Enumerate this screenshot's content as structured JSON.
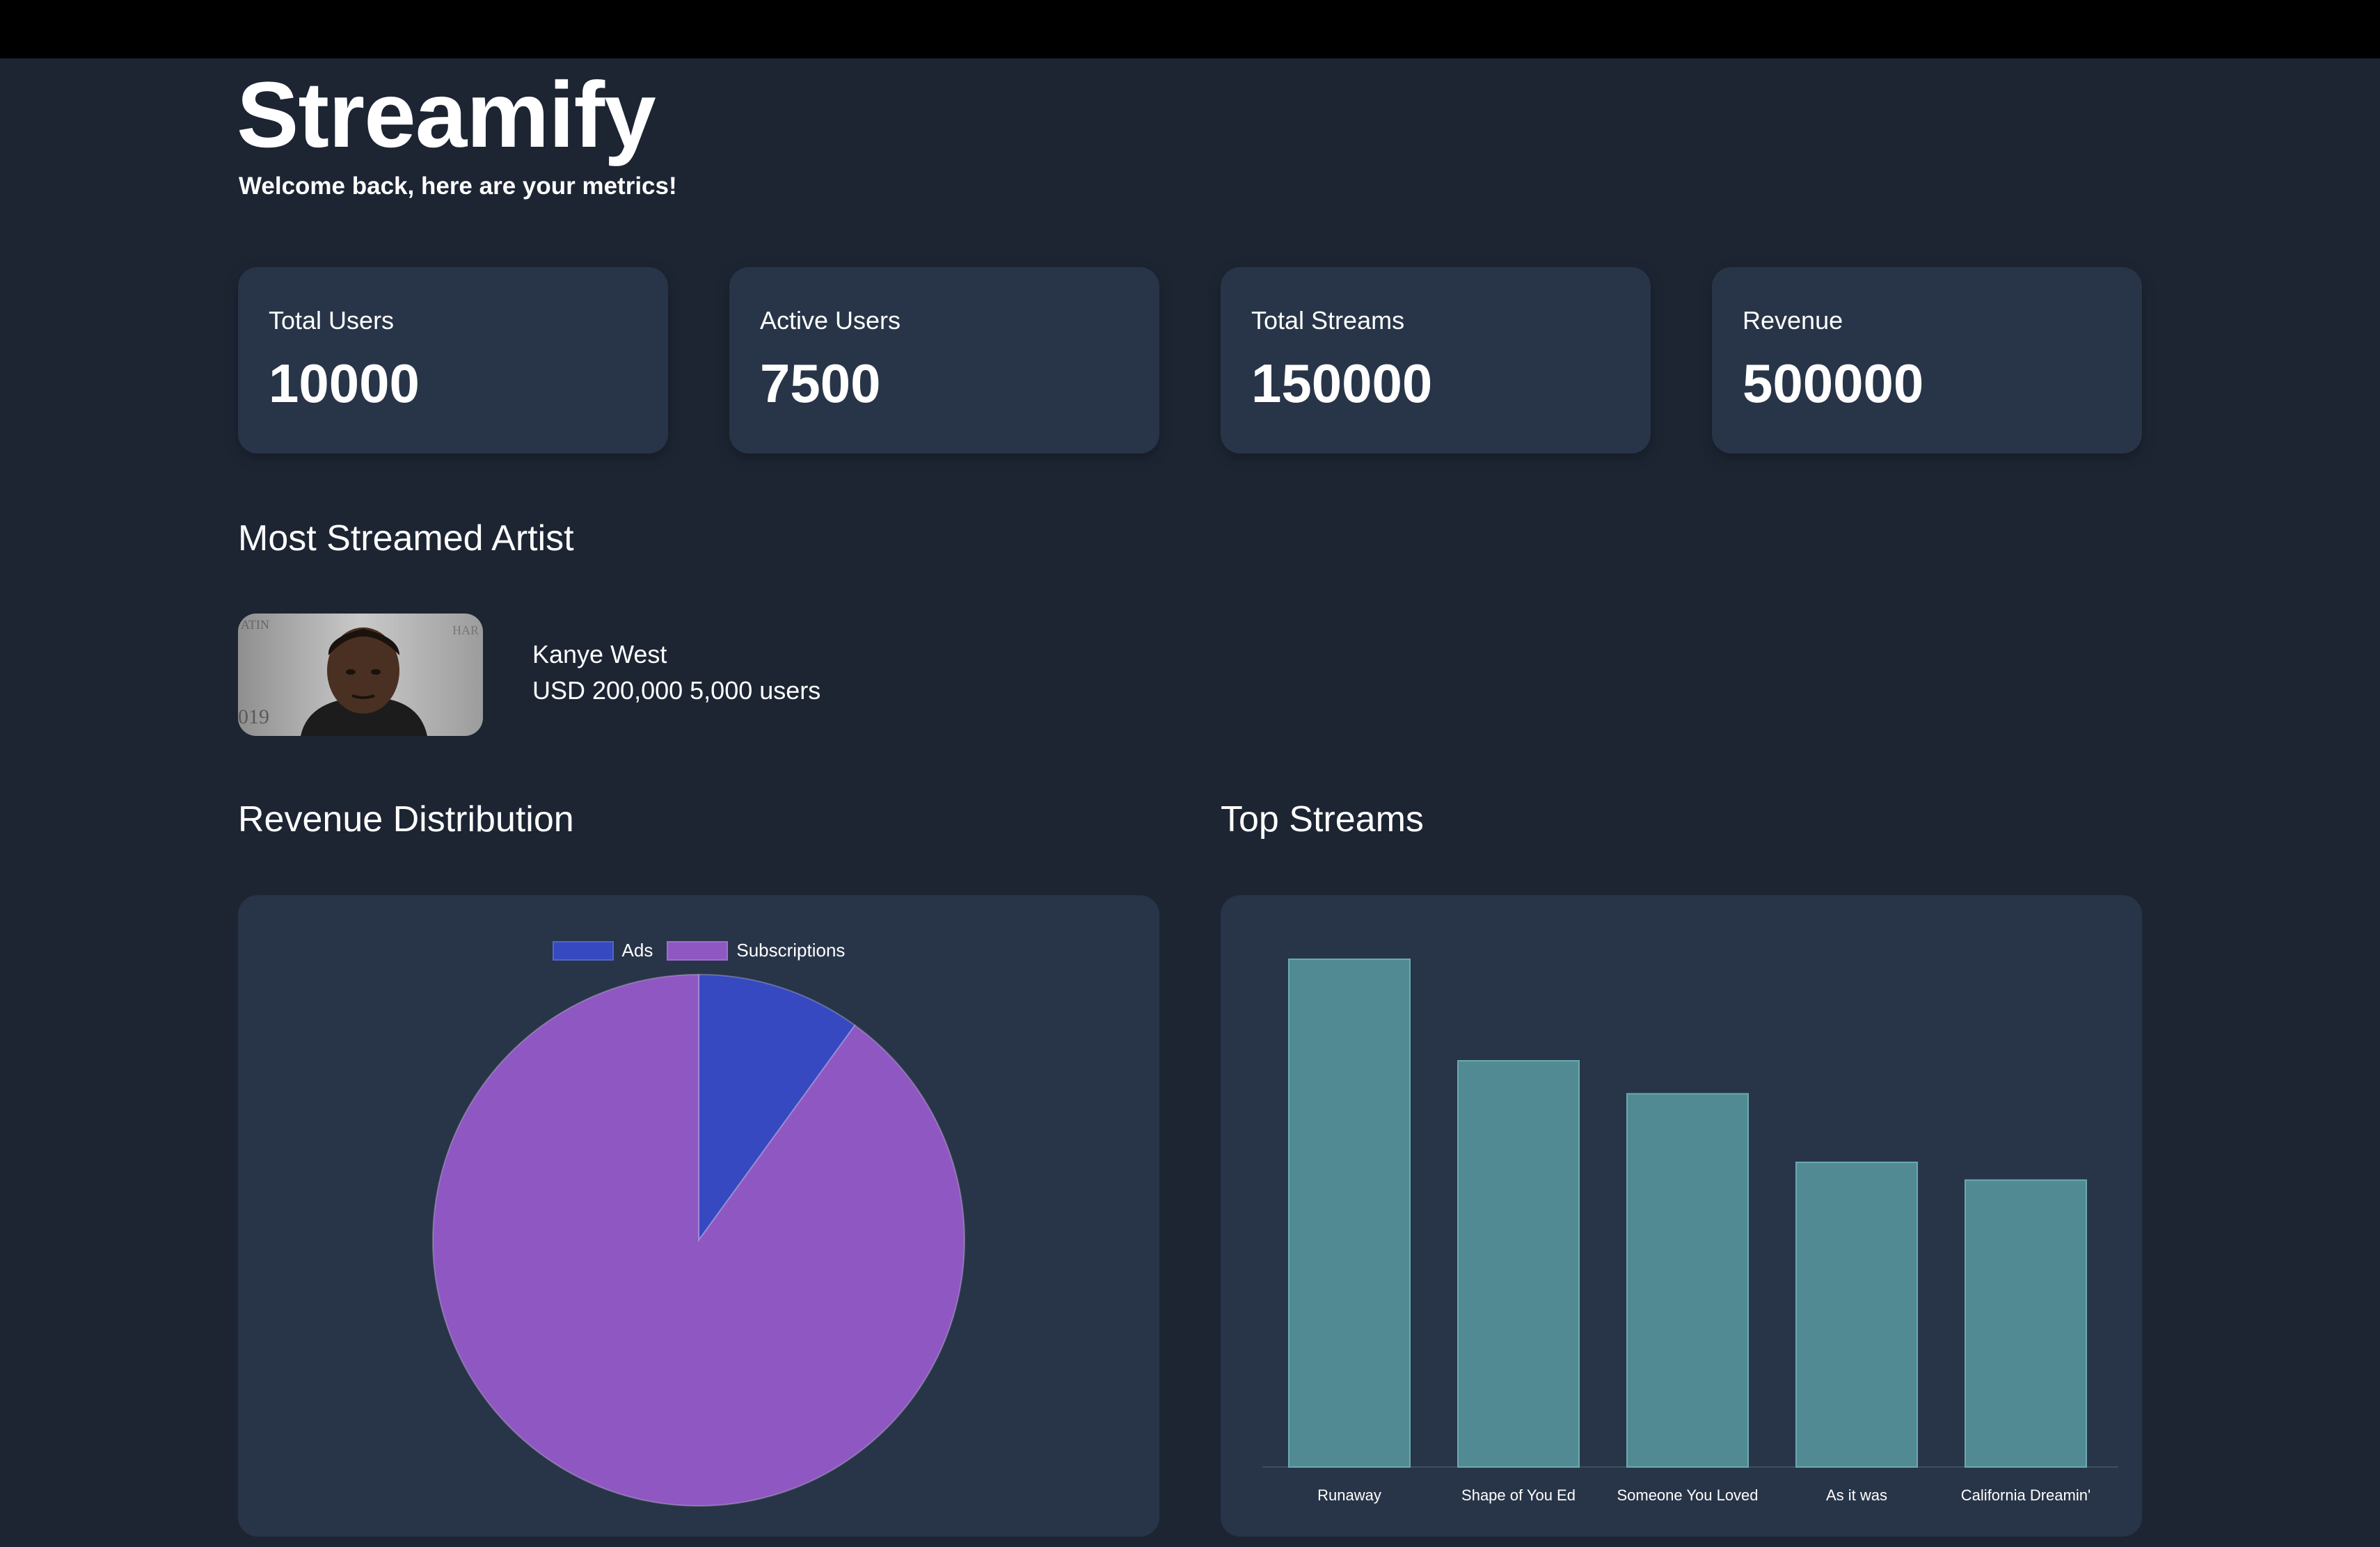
{
  "app": {
    "title": "Streamify",
    "subtitle": "Welcome back, here are your metrics!"
  },
  "stats": [
    {
      "label": "Total Users",
      "value": "10000"
    },
    {
      "label": "Active Users",
      "value": "7500"
    },
    {
      "label": "Total Streams",
      "value": "150000"
    },
    {
      "label": "Revenue",
      "value": "500000"
    }
  ],
  "most_streamed": {
    "section_title": "Most Streamed Artist",
    "artist_name": "Kanye West",
    "artist_stats": "USD 200,000 5,000 users"
  },
  "revenue_section": {
    "title": "Revenue Distribution"
  },
  "streams_section": {
    "title": "Top Streams"
  },
  "colors": {
    "background": "#1d2533",
    "card": "#283548",
    "ads": "#3649c0",
    "subscriptions": "#8e57c2",
    "bars": "#518a92"
  },
  "chart_data": [
    {
      "type": "pie",
      "legend": [
        "Ads",
        "Subscriptions"
      ],
      "legend_position": "top",
      "values": [
        10,
        90
      ],
      "colors": [
        "#3649c0",
        "#8e57c2"
      ]
    },
    {
      "type": "bar",
      "categories": [
        "Runaway",
        "Shape of You Ed",
        "Someone You Loved",
        "As it was",
        "California Dreamin'"
      ],
      "values": [
        100,
        80,
        73.5,
        60,
        56.5
      ],
      "ylim": [
        0,
        100
      ],
      "grid": false,
      "color": "#518a92"
    }
  ]
}
